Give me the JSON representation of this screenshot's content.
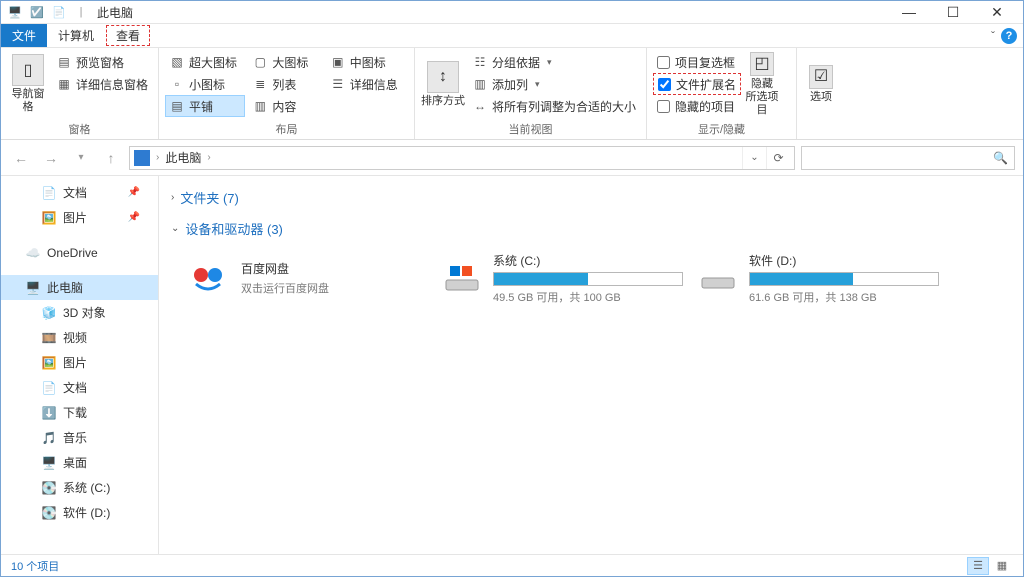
{
  "window": {
    "title": "此电脑"
  },
  "menu": {
    "file": "文件",
    "computer": "计算机",
    "view": "查看"
  },
  "ribbon": {
    "panes": {
      "label": "窗格",
      "navPane": "导航窗格",
      "previewPane": "预览窗格",
      "detailsPane": "详细信息窗格"
    },
    "layout": {
      "label": "布局",
      "extraLarge": "超大图标",
      "large": "大图标",
      "medium": "中图标",
      "small": "小图标",
      "list": "列表",
      "details": "详细信息",
      "tiles": "平铺",
      "content": "内容"
    },
    "currentView": {
      "label": "当前视图",
      "sortBy": "排序方式",
      "groupBy": "分组依据",
      "addColumns": "添加列",
      "sizeAll": "将所有列调整为合适的大小"
    },
    "showHide": {
      "label": "显示/隐藏",
      "itemCheckboxes": "项目复选框",
      "fileExtensions": "文件扩展名",
      "hiddenItems": "隐藏的项目",
      "hideSelected": "隐藏\n所选项目"
    },
    "options": {
      "label": "选项"
    }
  },
  "address": {
    "location": "此电脑"
  },
  "sidebar": {
    "docs": "文档",
    "pics": "图片",
    "onedrive": "OneDrive",
    "thispc": "此电脑",
    "objects3d": "3D 对象",
    "videos": "视频",
    "pics2": "图片",
    "docs2": "文档",
    "downloads": "下载",
    "music": "音乐",
    "desktop": "桌面",
    "driveC": "系统 (C:)",
    "driveD": "软件 (D:)"
  },
  "content": {
    "folders": {
      "label": "文件夹 (7)"
    },
    "drives": {
      "label": "设备和驱动器 (3)",
      "items": [
        {
          "title": "百度网盘",
          "sub": "双击运行百度网盘"
        },
        {
          "title": "系统 (C:)",
          "sub": "49.5 GB 可用，共 100 GB",
          "fill": 50
        },
        {
          "title": "软件 (D:)",
          "sub": "61.6 GB 可用，共 138 GB",
          "fill": 55
        }
      ]
    }
  },
  "status": {
    "countText": "10 个项目"
  }
}
